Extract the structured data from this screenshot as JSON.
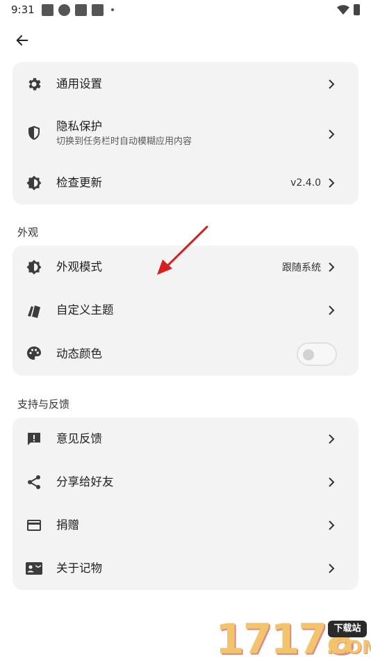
{
  "status_bar": {
    "time": "9:31"
  },
  "sections": {
    "general": {
      "items": [
        {
          "title": "通用设置"
        },
        {
          "title": "隐私保护",
          "subtitle": "切换到任务栏时自动模糊应用内容"
        },
        {
          "title": "检查更新",
          "value": "v2.4.0"
        }
      ]
    },
    "appearance": {
      "label": "外观",
      "items": [
        {
          "title": "外观模式",
          "value": "跟随系统"
        },
        {
          "title": "自定义主题"
        },
        {
          "title": "动态颜色",
          "toggle_on": false
        }
      ]
    },
    "support": {
      "label": "支持与反馈",
      "items": [
        {
          "title": "意见反馈"
        },
        {
          "title": "分享给好友"
        },
        {
          "title": "捐赠"
        },
        {
          "title": "关于记物"
        }
      ]
    }
  },
  "watermark": {
    "digits": "17178",
    "badge": "下载站",
    "suffix": ".COM"
  },
  "colors": {
    "card_bg": "#f3f3f3",
    "icon": "#3c3c3c",
    "annotation_arrow": "#d62020"
  }
}
